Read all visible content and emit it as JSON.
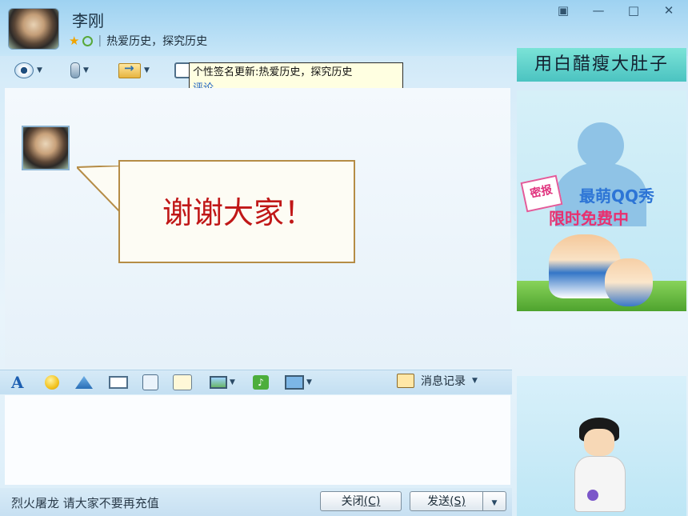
{
  "header": {
    "contact_name": "李刚",
    "signature": "热爱历史，探究历史",
    "window_buttons": [
      "▣",
      "—",
      "□",
      "✕"
    ]
  },
  "toolbar": {
    "icons": [
      "eye-icon",
      "microphone-icon",
      "send-file-icon",
      "chat-icon"
    ]
  },
  "tooltip": {
    "text": "个性签名更新:热爱历史，探究历史",
    "link": "评论"
  },
  "banner": {
    "text": "用白醋瘦大肚子"
  },
  "chat": {
    "message": "谢谢大家！"
  },
  "ad": {
    "tag": "密报",
    "line1": "最萌QQ秀",
    "line2": "限时免费中"
  },
  "format_toolbar": {
    "icons": [
      "font-icon",
      "emoji-icon",
      "magic-icon",
      "video-icon",
      "voice-icon",
      "pen-icon",
      "image-icon",
      "music-icon",
      "screenshot-icon"
    ],
    "history_label": "消息记录"
  },
  "status": {
    "text": "烈火屠龙 请大家不要再充值"
  },
  "buttons": {
    "close_label": "关闭",
    "close_key": "(C)",
    "send_label": "发送",
    "send_key": "(S)"
  },
  "colors": {
    "message_text": "#c01717",
    "bubble_border": "#b58c46",
    "link": "#1b5fc2"
  }
}
